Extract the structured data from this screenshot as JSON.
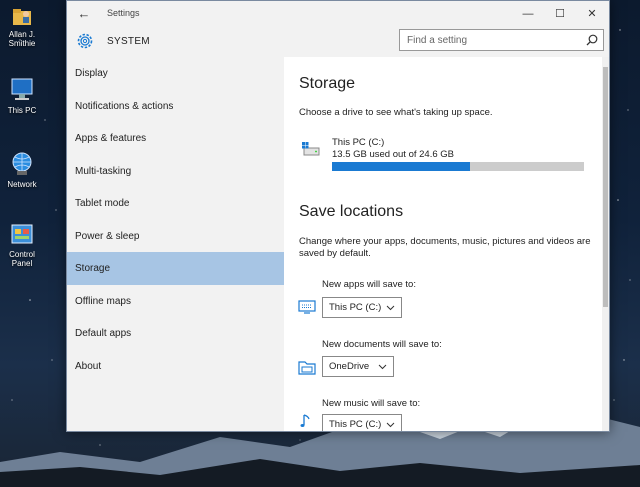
{
  "desktop": {
    "icons": [
      {
        "label_line1": "Allan J.",
        "label_line2": "Smithie"
      },
      {
        "label_line1": "This PC",
        "label_line2": ""
      },
      {
        "label_line1": "Network",
        "label_line2": ""
      },
      {
        "label_line1": "Control",
        "label_line2": "Panel"
      }
    ]
  },
  "window": {
    "title": "Settings",
    "section": "SYSTEM",
    "search_placeholder": "Find a setting",
    "controls": {
      "minimize": "—",
      "maximize": "☐",
      "close": "✕"
    }
  },
  "sidebar": {
    "items": [
      {
        "label": "Display"
      },
      {
        "label": "Notifications & actions"
      },
      {
        "label": "Apps & features"
      },
      {
        "label": "Multi-tasking"
      },
      {
        "label": "Tablet mode"
      },
      {
        "label": "Power & sleep"
      },
      {
        "label": "Storage",
        "selected": true
      },
      {
        "label": "Offline maps"
      },
      {
        "label": "Default apps"
      },
      {
        "label": "About"
      }
    ]
  },
  "storage": {
    "heading": "Storage",
    "description": "Choose a drive to see what's taking up space.",
    "drive": {
      "name": "This PC (C:)",
      "usage_text": "13.5 GB used out of 24.6 GB",
      "used_gb": 13.5,
      "total_gb": 24.6
    }
  },
  "save_locations": {
    "heading": "Save locations",
    "description": "Change where your apps, documents, music, pictures and videos are saved by default.",
    "items": [
      {
        "label": "New apps will save to:",
        "value": "This PC (C:)",
        "icon": "monitor-icon"
      },
      {
        "label": "New documents will save to:",
        "value": "OneDrive",
        "icon": "document-folder-icon"
      },
      {
        "label": "New music will save to:",
        "value": "This PC (C:)",
        "icon": "music-note-icon"
      }
    ]
  },
  "colors": {
    "accent": "#1a7ad2",
    "selected_nav": "#a7c5e4",
    "sidebar_bg": "#f2f2f2"
  }
}
